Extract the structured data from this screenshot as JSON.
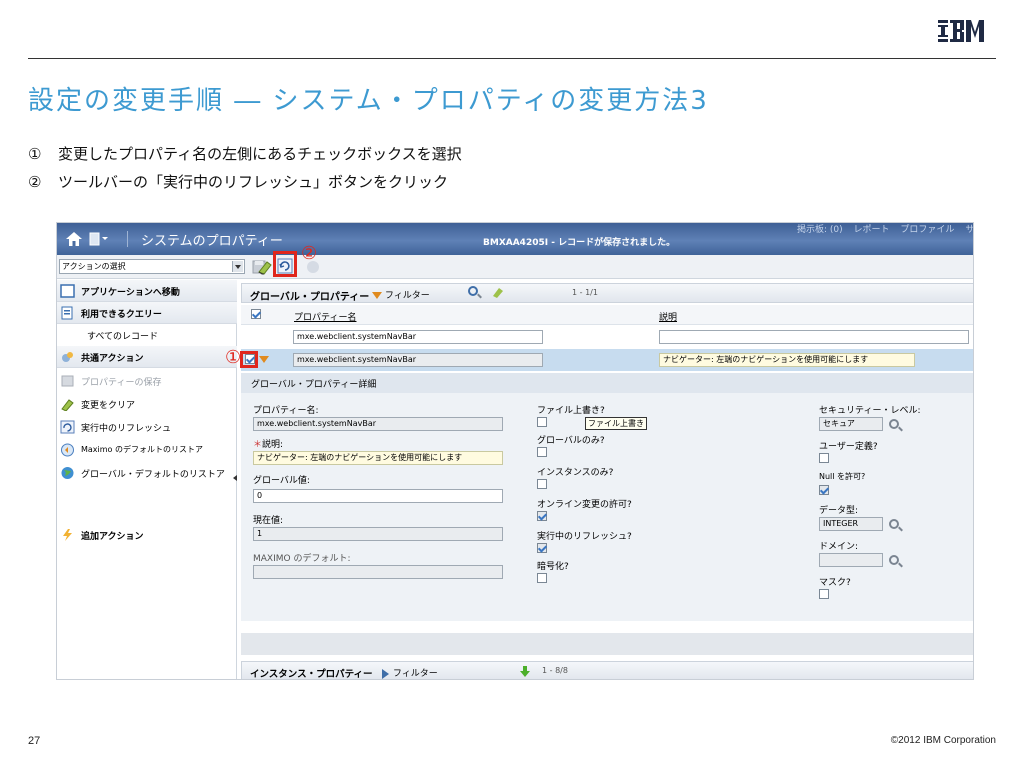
{
  "brand": {
    "logo_text": "IBM"
  },
  "slide": {
    "title": "設定の変更手順 ― システム・プロパティの変更方法3",
    "steps": [
      {
        "num": "①",
        "text": "変更したプロパティ名の左側にあるチェックボックスを選択"
      },
      {
        "num": "②",
        "text": "ツールバーの「実行中のリフレッシュ」ボタンをクリック"
      }
    ],
    "page_number": "27",
    "copyright": "©2012 IBM Corporation",
    "callouts": {
      "one": "①",
      "two": "②"
    },
    "accent_color": "#3d9ad1",
    "highlight_color": "#e0261c"
  },
  "app": {
    "title": "システムのプロパティー",
    "status_message": "BMXAA4205I - レコードが保存されました。",
    "header_links": [
      "掲示板: (0)",
      "レポート",
      "プロファイル",
      "サインア"
    ],
    "toolbar": {
      "action_select_value": "アクションの選択",
      "icons": [
        "save-icon",
        "eraser-icon",
        "refresh-icon",
        "help-icon"
      ]
    },
    "sidebar": {
      "go_to_apps": "アプリケーションへ移動",
      "queries_header": "利用できるクエリー",
      "all_records": "すべてのレコード",
      "common_actions_header": "共通アクション",
      "save_property": "プロパティーの保存",
      "clear_changes": "変更をクリア",
      "live_refresh": "実行中のリフレッシュ",
      "restore_maximo_default": "Maximo のデフォルトのリストア",
      "restore_global_default": "グローバル・デフォルトのリストア",
      "more_actions": "追加アクション"
    },
    "global_properties": {
      "title": "グローバル・プロパティー",
      "filter_label": "フィルター",
      "pager": "1 - 1/1",
      "col_property_name": "プロパティー名",
      "col_description": "説明",
      "filter_value": "mxe.webclient.systemNavBar",
      "row": {
        "checked": true,
        "property_name": "mxe.webclient.systemNavBar",
        "description": "ナビゲーター: 左端のナビゲーションを使用可能にします"
      }
    },
    "detail": {
      "title": "グローバル・プロパティー詳細",
      "property_name_label": "プロパティー名:",
      "property_name_value": "mxe.webclient.systemNavBar",
      "description_label": "説明:",
      "description_value": "ナビゲーター: 左端のナビゲーションを使用可能にします",
      "global_value_label": "グローバル値:",
      "global_value": "0",
      "current_value_label": "現在値:",
      "current_value": "1",
      "maximo_default_label": "MAXIMO のデフォルト:",
      "maximo_default_value": "",
      "file_override_label": "ファイル上書き?",
      "file_override_tooltip": "ファイル上書き",
      "global_only_label": "グローバルのみ?",
      "instance_only_label": "インスタンスのみ?",
      "online_change_label": "オンライン変更の許可?",
      "live_refresh_label": "実行中のリフレッシュ?",
      "encrypted_label": "暗号化?",
      "security_level_label": "セキュリティー・レベル:",
      "security_level_value": "セキュア",
      "user_defined_label": "ユーザー定義?",
      "null_allowed_label": "Null を許可?",
      "data_type_label": "データ型:",
      "data_type_value": "INTEGER",
      "domain_label": "ドメイン:",
      "mask_label": "マスク?",
      "checks": {
        "file_override": false,
        "global_only": false,
        "instance_only": false,
        "online_change": true,
        "live_refresh": true,
        "encrypted": false,
        "user_defined": false,
        "null_allowed": true,
        "mask": false
      }
    },
    "instance_properties": {
      "title": "インスタンス・プロパティー",
      "filter_label": "フィルター",
      "pager": "1 - 8/8"
    }
  }
}
